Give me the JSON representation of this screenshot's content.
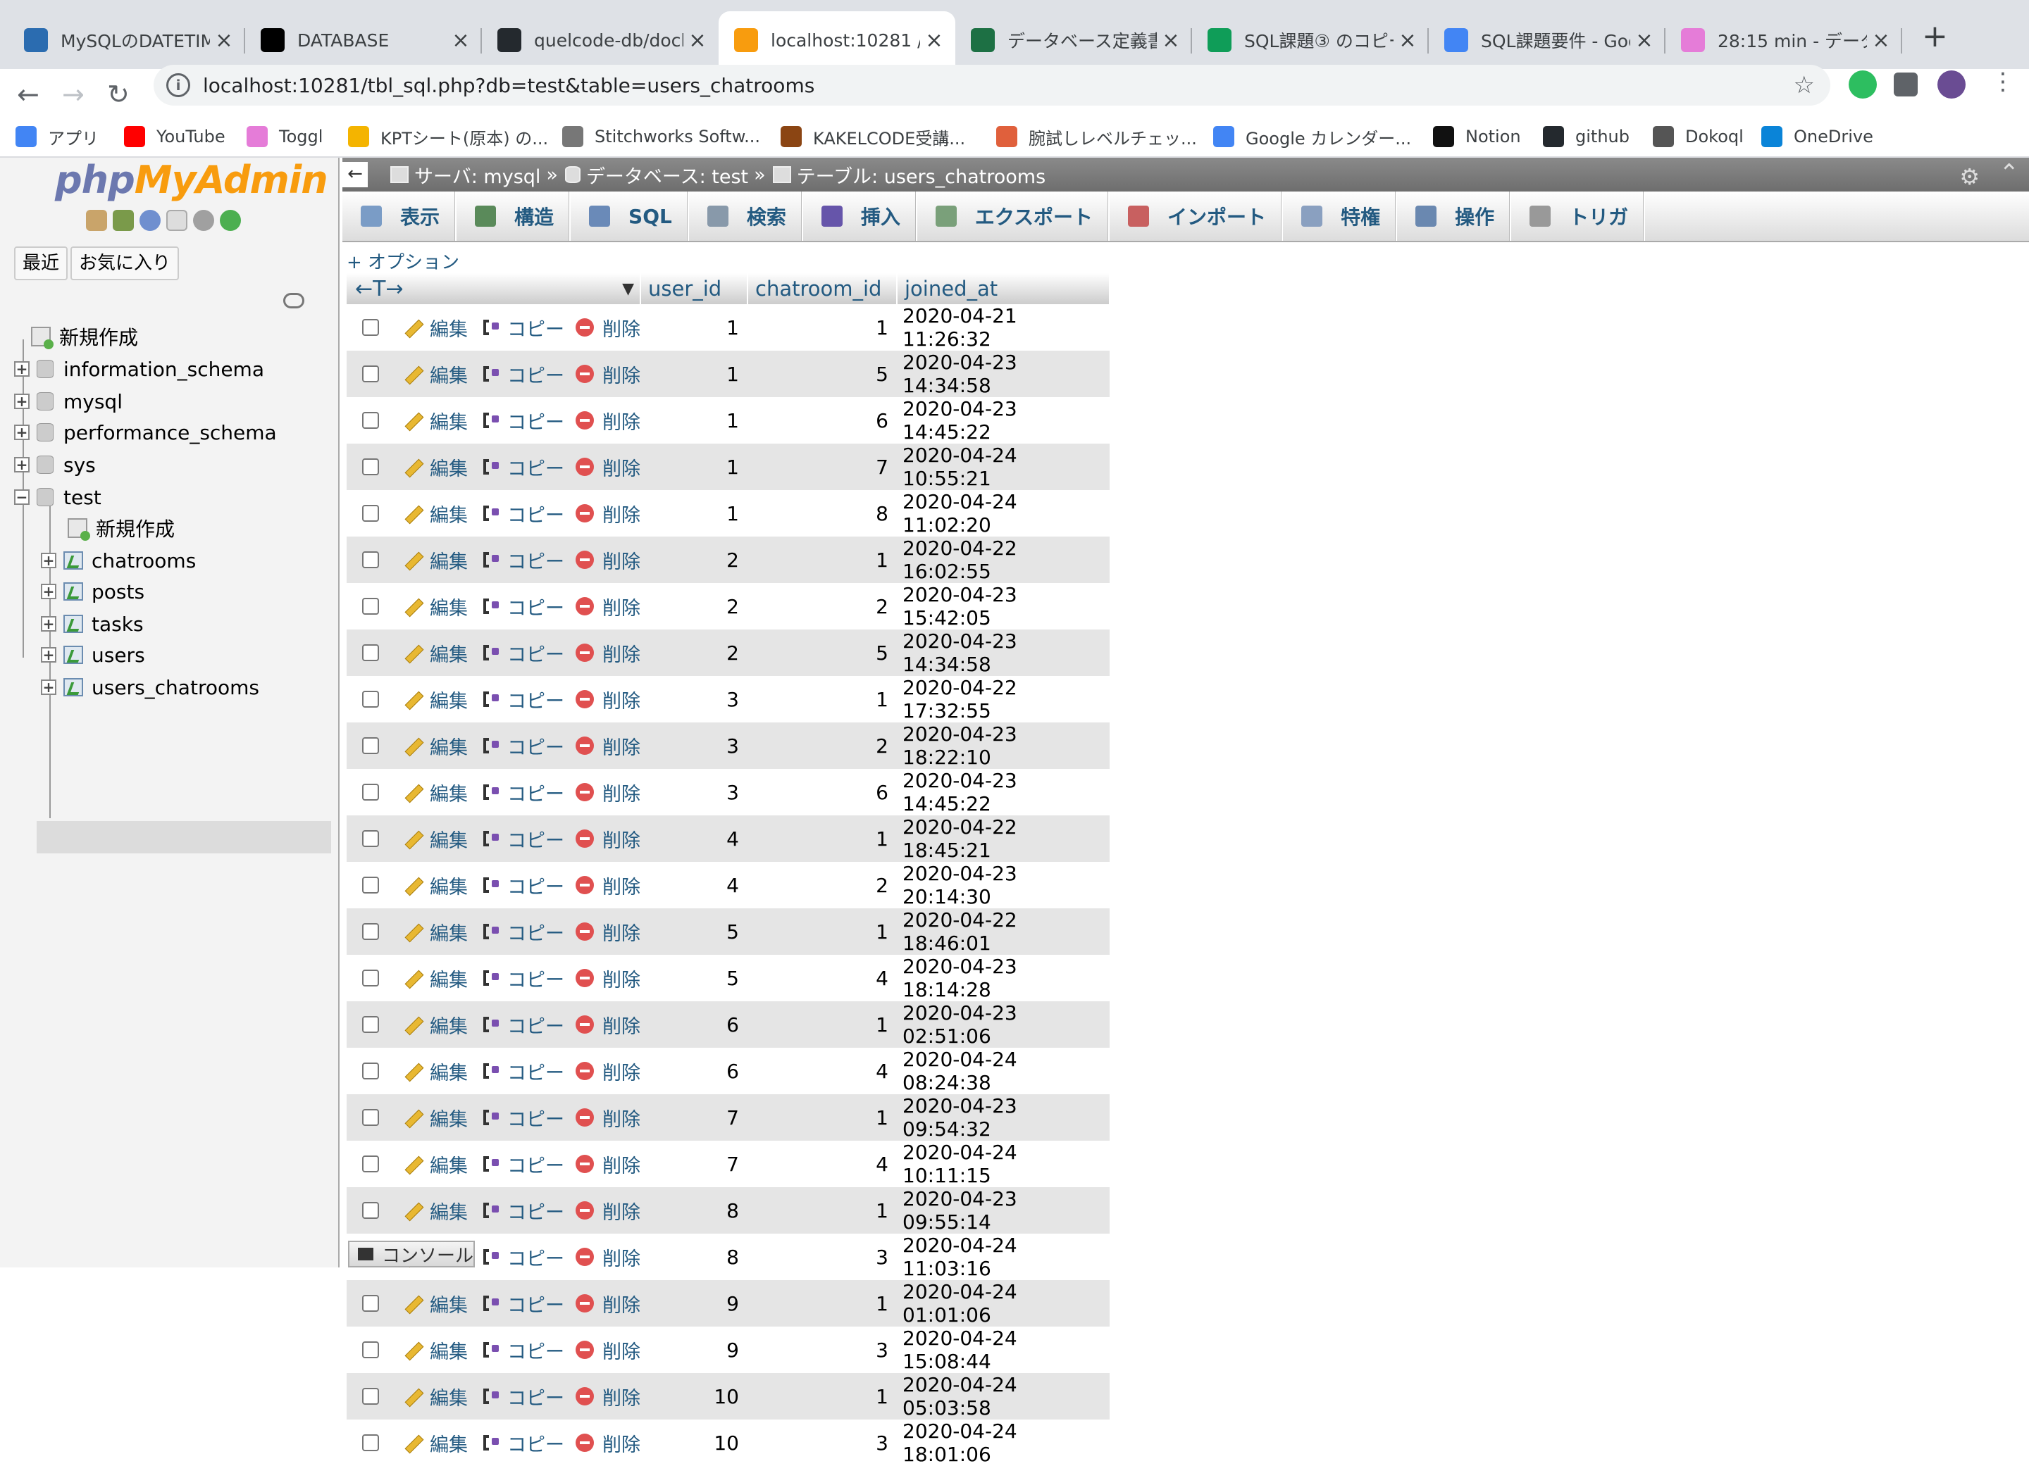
{
  "browser": {
    "tabs": [
      {
        "title": "MySQLのDATETIM",
        "icon": "j-doc-icon",
        "color": "#2b6cb0"
      },
      {
        "title": "DATABASE",
        "icon": "diamond-icon",
        "color": "#000000"
      },
      {
        "title": "quelcode-db/dock",
        "icon": "github-icon",
        "color": "#24292e"
      },
      {
        "title": "localhost:10281 / r",
        "icon": "pma-icon",
        "color": "#f89c0e"
      },
      {
        "title": "データベース定義書",
        "icon": "excel-icon",
        "color": "#1d7044"
      },
      {
        "title": "SQL課題③ のコピー",
        "icon": "sheets-icon",
        "color": "#0f9d58"
      },
      {
        "title": "SQL課題要件 - Goo",
        "icon": "docs-icon",
        "color": "#4285f4"
      },
      {
        "title": "28:15 min - データ",
        "icon": "toggl-icon",
        "color": "#e57cd8"
      }
    ],
    "url": "localhost:10281/tbl_sql.php?db=test&table=users_chatrooms",
    "bookmarks": [
      {
        "label": "アプリ",
        "icon": "apps-grid-icon",
        "color": "#4285f4"
      },
      {
        "label": "YouTube",
        "icon": "youtube-icon",
        "color": "#ff0000"
      },
      {
        "label": "Toggl",
        "icon": "toggl-icon",
        "color": "#e57cd8"
      },
      {
        "label": "KPTシート(原本) の...",
        "icon": "slides-icon",
        "color": "#f4b400"
      },
      {
        "label": "Stitchworks Softw...",
        "icon": "stitch-icon",
        "color": "#777777"
      },
      {
        "label": "KAKELCODE受講...",
        "icon": "book-icon",
        "color": "#8b4513"
      },
      {
        "label": "腕試しレベルチェッ...",
        "icon": "face-icon",
        "color": "#e0603c"
      },
      {
        "label": "Google カレンダー...",
        "icon": "calendar-icon",
        "color": "#4285f4"
      },
      {
        "label": "Notion",
        "icon": "notion-icon",
        "color": "#111111"
      },
      {
        "label": "github",
        "icon": "github-icon",
        "color": "#24292e"
      },
      {
        "label": "Dokoql",
        "icon": "globe-icon",
        "color": "#555555"
      },
      {
        "label": "OneDrive",
        "icon": "cloud-icon",
        "color": "#0a84d8"
      }
    ]
  },
  "nav": {
    "logo_php": "php",
    "logo_myadmin": "MyAdmin",
    "recent_label": "最近",
    "favorites_label": "お気に入り",
    "tree": {
      "new_label": "新規作成",
      "databases": [
        "information_schema",
        "mysql",
        "performance_schema",
        "sys",
        "test"
      ],
      "test_new_label": "新規作成",
      "tables": [
        "chatrooms",
        "posts",
        "tasks",
        "users",
        "users_chatrooms"
      ]
    }
  },
  "breadcrumb": {
    "server": "サーバ: mysql",
    "database": "データベース: test",
    "table": "テーブル: users_chatrooms",
    "sep": "»"
  },
  "menu": [
    "表示",
    "構造",
    "SQL",
    "検索",
    "挿入",
    "エクスポート",
    "インポート",
    "特権",
    "操作",
    "トリガ"
  ],
  "options_label": "+ オプション",
  "table": {
    "arrows": "←T→",
    "columns": [
      "user_id",
      "chatroom_id",
      "joined_at"
    ],
    "actions": {
      "edit": "編集",
      "copy": "コピー",
      "delete": "削除"
    },
    "rows": [
      [
        1,
        1,
        "2020-04-21 11:26:32"
      ],
      [
        1,
        5,
        "2020-04-23 14:34:58"
      ],
      [
        1,
        6,
        "2020-04-23 14:45:22"
      ],
      [
        1,
        7,
        "2020-04-24 10:55:21"
      ],
      [
        1,
        8,
        "2020-04-24 11:02:20"
      ],
      [
        2,
        1,
        "2020-04-22 16:02:55"
      ],
      [
        2,
        2,
        "2020-04-23 15:42:05"
      ],
      [
        2,
        5,
        "2020-04-23 14:34:58"
      ],
      [
        3,
        1,
        "2020-04-22 17:32:55"
      ],
      [
        3,
        2,
        "2020-04-23 18:22:10"
      ],
      [
        3,
        6,
        "2020-04-23 14:45:22"
      ],
      [
        4,
        1,
        "2020-04-22 18:45:21"
      ],
      [
        4,
        2,
        "2020-04-23 20:14:30"
      ],
      [
        5,
        1,
        "2020-04-22 18:46:01"
      ],
      [
        5,
        4,
        "2020-04-23 18:14:28"
      ],
      [
        6,
        1,
        "2020-04-23 02:51:06"
      ],
      [
        6,
        4,
        "2020-04-24 08:24:38"
      ],
      [
        7,
        1,
        "2020-04-23 09:54:32"
      ],
      [
        7,
        4,
        "2020-04-24 10:11:15"
      ],
      [
        8,
        1,
        "2020-04-23 09:55:14"
      ],
      [
        8,
        3,
        "2020-04-24 11:03:16"
      ],
      [
        9,
        1,
        "2020-04-24 01:01:06"
      ],
      [
        9,
        3,
        "2020-04-24 15:08:44"
      ],
      [
        10,
        1,
        "2020-04-24 05:03:58"
      ],
      [
        10,
        3,
        "2020-04-24 18:01:06"
      ]
    ]
  },
  "console_label": "コンソール"
}
